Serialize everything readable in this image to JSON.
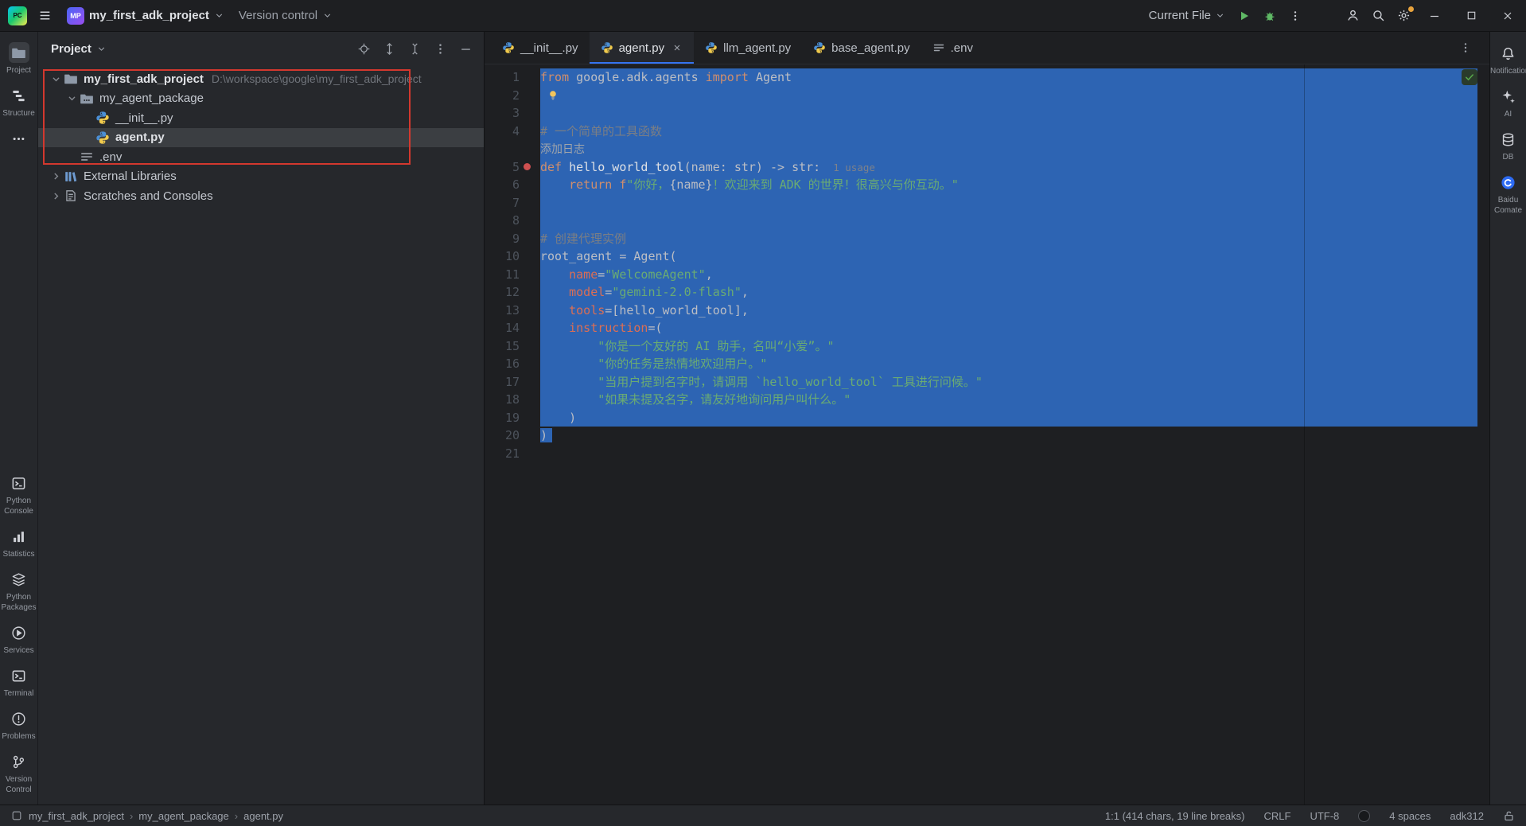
{
  "colors": {
    "selection_blue": "#2d64b3",
    "annotation_red": "#d3382e",
    "tab_accent_blue": "#3574f0",
    "run_green": "#5fb865",
    "comate_blue": "#2d6bf2",
    "string_green": "#6aab73",
    "keyword_orange": "#cf8e6d",
    "named_arg_salmon": "#dc6e54"
  },
  "title_bar": {
    "app": "PC",
    "project_badge": "MP",
    "project_name": "my_first_adk_project",
    "version_control_label": "Version control",
    "run_config_label": "Current File"
  },
  "left_stripe": {
    "top": [
      {
        "id": "project",
        "label": "Project",
        "icon": "folder",
        "active": true
      },
      {
        "id": "structure",
        "label": "Structure",
        "icon": "structure"
      },
      {
        "id": "more-tools",
        "label": "",
        "icon": "more"
      }
    ],
    "bottom": [
      {
        "id": "python-console",
        "label": "Python Console",
        "icon": "console"
      },
      {
        "id": "statistics",
        "label": "Statistics",
        "icon": "statistics"
      },
      {
        "id": "python-packages",
        "label": "Python Packages",
        "icon": "packages"
      },
      {
        "id": "services",
        "label": "Services",
        "icon": "services"
      },
      {
        "id": "terminal",
        "label": "Terminal",
        "icon": "terminal"
      },
      {
        "id": "problems",
        "label": "Problems",
        "icon": "problems"
      },
      {
        "id": "version-control",
        "label": "Version Control",
        "icon": "branch"
      }
    ]
  },
  "right_stripe": [
    {
      "id": "notifications",
      "label": "Notifications",
      "icon": "bell"
    },
    {
      "id": "ai",
      "label": "AI",
      "icon": "ai"
    },
    {
      "id": "db",
      "label": "DB",
      "icon": "db"
    },
    {
      "id": "baidu-comate",
      "label": "Baidu Comate",
      "icon": "comate"
    }
  ],
  "project_panel": {
    "title": "Project",
    "tree": [
      {
        "name": "my_first_adk_project",
        "path": "D:\\workspace\\google\\my_first_adk_project",
        "level": 0,
        "icon": "folder",
        "chev": "down",
        "bold": true
      },
      {
        "name": "my_agent_package",
        "level": 1,
        "icon": "package",
        "chev": "down"
      },
      {
        "name": "__init__.py",
        "level": 2,
        "icon": "python"
      },
      {
        "name": "agent.py",
        "level": 2,
        "icon": "python",
        "selected": true
      },
      {
        "name": ".env",
        "level": 1,
        "icon": "env"
      },
      {
        "name": "External Libraries",
        "level": 0,
        "icon": "libraries",
        "chev": "right"
      },
      {
        "name": "Scratches and Consoles",
        "level": 0,
        "icon": "scratches",
        "chev": "right"
      }
    ]
  },
  "editor": {
    "tabs": [
      {
        "label": "__init__.py",
        "icon": "python"
      },
      {
        "label": "agent.py",
        "icon": "python",
        "active": true
      },
      {
        "label": "llm_agent.py",
        "icon": "python"
      },
      {
        "label": "base_agent.py",
        "icon": "python"
      },
      {
        "label": ".env",
        "icon": "env"
      }
    ],
    "lines": [
      {
        "n": "1",
        "sel": true,
        "tokens": [
          {
            "t": "from ",
            "c": "k"
          },
          {
            "t": "google.adk.agents ",
            "c": "d"
          },
          {
            "t": "import ",
            "c": "k"
          },
          {
            "t": "Agent",
            "c": "d"
          }
        ]
      },
      {
        "n": "2",
        "sel": true,
        "bulb": true,
        "tokens": []
      },
      {
        "n": "3",
        "sel": true,
        "tokens": []
      },
      {
        "n": "4",
        "sel": true,
        "tokens": [
          {
            "t": "# 一个简单的工具函数",
            "c": "c"
          }
        ]
      },
      {
        "inlay": "添加日志",
        "sel": true
      },
      {
        "n": "5",
        "sel": true,
        "dot": true,
        "tokens": [
          {
            "t": "def ",
            "c": "k"
          },
          {
            "t": "hello_world_tool",
            "c": "fn"
          },
          {
            "t": "(name: str) -> str:",
            "c": "d"
          },
          {
            "t": "1 usage",
            "c": "hint"
          }
        ]
      },
      {
        "n": "6",
        "sel": true,
        "tokens": [
          {
            "t": "    ",
            "c": "d"
          },
          {
            "t": "return ",
            "c": "k"
          },
          {
            "t": "f",
            "c": "k"
          },
          {
            "t": "\"你好，",
            "c": "s"
          },
          {
            "t": "{name}",
            "c": "d"
          },
          {
            "t": "！欢迎来到 ADK 的世界！很高兴与你互动。\"",
            "c": "s"
          }
        ]
      },
      {
        "n": "7",
        "sel": true,
        "tokens": []
      },
      {
        "n": "8",
        "sel": true,
        "tokens": []
      },
      {
        "n": "9",
        "sel": true,
        "tokens": [
          {
            "t": "# 创建代理实例",
            "c": "c"
          }
        ]
      },
      {
        "n": "10",
        "sel": true,
        "tokens": [
          {
            "t": "root_agent = Agent(",
            "c": "d"
          }
        ]
      },
      {
        "n": "11",
        "sel": true,
        "tokens": [
          {
            "t": "    ",
            "c": "d"
          },
          {
            "t": "name",
            "c": "a"
          },
          {
            "t": "=",
            "c": "d"
          },
          {
            "t": "\"WelcomeAgent\"",
            "c": "s"
          },
          {
            "t": ",",
            "c": "d"
          }
        ]
      },
      {
        "n": "12",
        "sel": true,
        "tokens": [
          {
            "t": "    ",
            "c": "d"
          },
          {
            "t": "model",
            "c": "a"
          },
          {
            "t": "=",
            "c": "d"
          },
          {
            "t": "\"gemini-2.0-flash\"",
            "c": "s"
          },
          {
            "t": ",",
            "c": "d"
          }
        ]
      },
      {
        "n": "13",
        "sel": true,
        "tokens": [
          {
            "t": "    ",
            "c": "d"
          },
          {
            "t": "tools",
            "c": "a"
          },
          {
            "t": "=[hello_world_tool],",
            "c": "d"
          }
        ]
      },
      {
        "n": "14",
        "sel": true,
        "tokens": [
          {
            "t": "    ",
            "c": "d"
          },
          {
            "t": "instruction",
            "c": "a"
          },
          {
            "t": "=(",
            "c": "d"
          }
        ]
      },
      {
        "n": "15",
        "sel": true,
        "tokens": [
          {
            "t": "        ",
            "c": "d"
          },
          {
            "t": "\"你是一个友好的 AI 助手，名叫“小爱”。\"",
            "c": "s"
          }
        ]
      },
      {
        "n": "16",
        "sel": true,
        "tokens": [
          {
            "t": "        ",
            "c": "d"
          },
          {
            "t": "\"你的任务是热情地欢迎用户。\"",
            "c": "s"
          }
        ]
      },
      {
        "n": "17",
        "sel": true,
        "tokens": [
          {
            "t": "        ",
            "c": "d"
          },
          {
            "t": "\"当用户提到名字时，请调用 `hello_world_tool` 工具进行问候。\"",
            "c": "s"
          }
        ]
      },
      {
        "n": "18",
        "sel": true,
        "tokens": [
          {
            "t": "        ",
            "c": "d"
          },
          {
            "t": "\"如果未提及名字，请友好地询问用户叫什么。\"",
            "c": "s"
          }
        ]
      },
      {
        "n": "19",
        "sel": true,
        "tokens": [
          {
            "t": "    )",
            "c": "d"
          }
        ]
      },
      {
        "n": "20",
        "tokens": [
          {
            "t": ")",
            "c": "d",
            "sel": true
          }
        ]
      },
      {
        "n": "21",
        "tokens": []
      }
    ]
  },
  "status_bar": {
    "breadcrumbs": [
      "my_first_adk_project",
      "my_agent_package",
      "agent.py"
    ],
    "caret_info": "1:1 (414 chars, 19 line breaks)",
    "line_separator": "CRLF",
    "encoding": "UTF-8",
    "indent": "4 spaces",
    "interpreter": "adk312"
  }
}
